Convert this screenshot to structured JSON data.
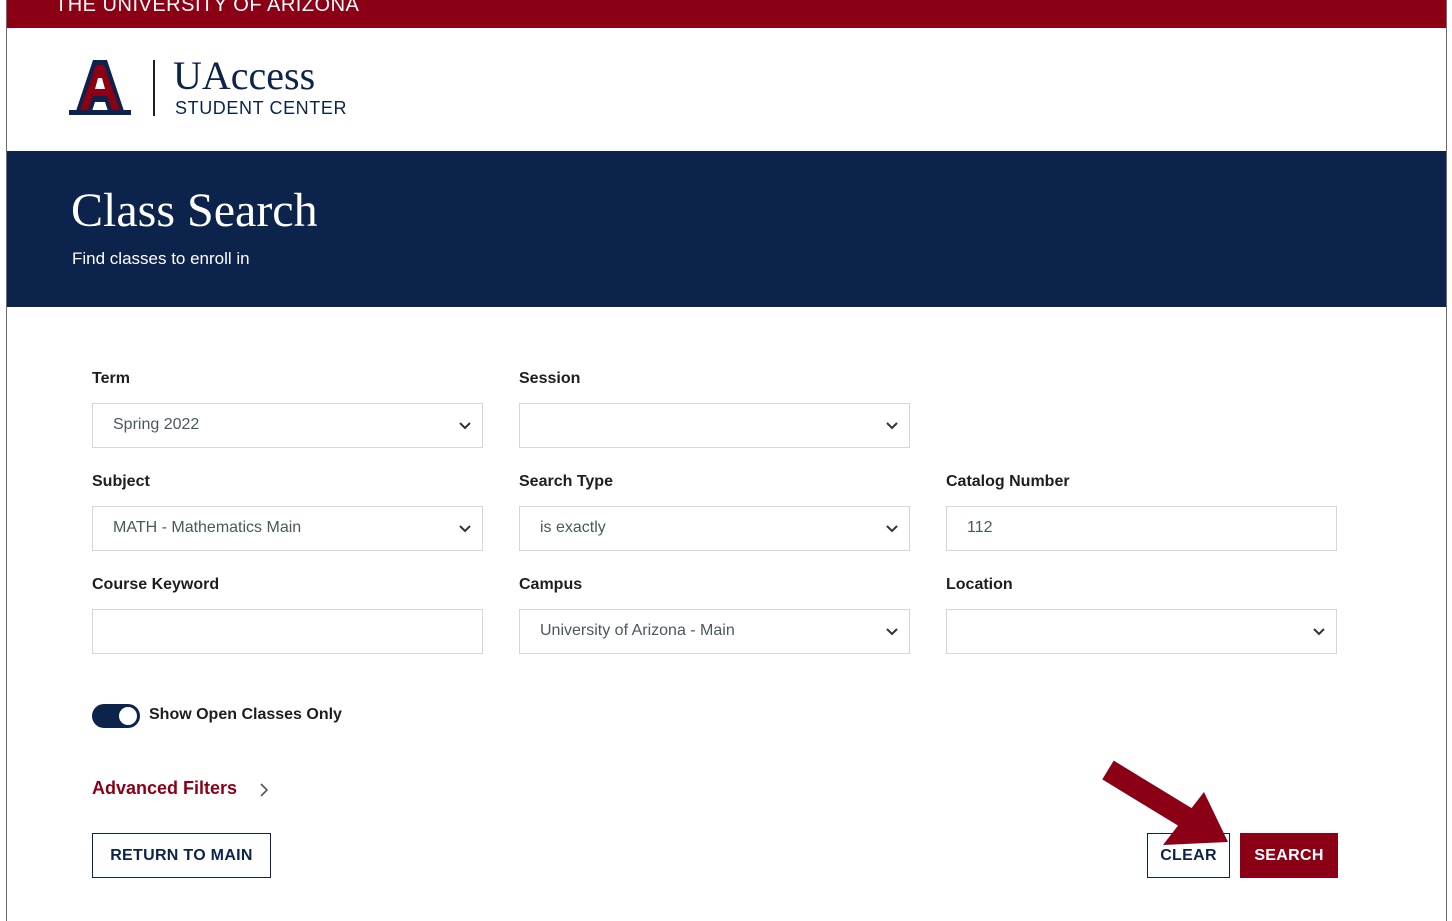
{
  "header": {
    "university": "THE UNIVERSITY OF ARIZONA",
    "brand_name": "UAccess",
    "brand_sub": "STUDENT CENTER"
  },
  "hero": {
    "title": "Class Search",
    "subtitle": "Find classes to enroll in"
  },
  "form": {
    "term": {
      "label": "Term",
      "value": "Spring 2022"
    },
    "session": {
      "label": "Session",
      "value": ""
    },
    "subject": {
      "label": "Subject",
      "value": "MATH - Mathematics Main"
    },
    "search_type": {
      "label": "Search Type",
      "value": "is exactly"
    },
    "catalog_number": {
      "label": "Catalog Number",
      "value": "112"
    },
    "course_keyword": {
      "label": "Course Keyword",
      "value": ""
    },
    "campus": {
      "label": "Campus",
      "value": "University of Arizona - Main"
    },
    "location": {
      "label": "Location",
      "value": ""
    },
    "open_only": {
      "label": "Show Open Classes Only",
      "checked": true
    },
    "advanced_filters": "Advanced Filters"
  },
  "actions": {
    "return_main": "RETURN TO MAIN",
    "clear": "CLEAR",
    "search": "SEARCH"
  },
  "colors": {
    "brand_red": "#8b0015",
    "brand_navy": "#0c234b",
    "callout_arrow": "#8b0015"
  },
  "icons": {
    "logo": "ua-block-a-logo",
    "select_chevron": "chevron-down-icon",
    "advanced_chevron": "chevron-right-icon",
    "callout": "arrow-callout-icon"
  }
}
